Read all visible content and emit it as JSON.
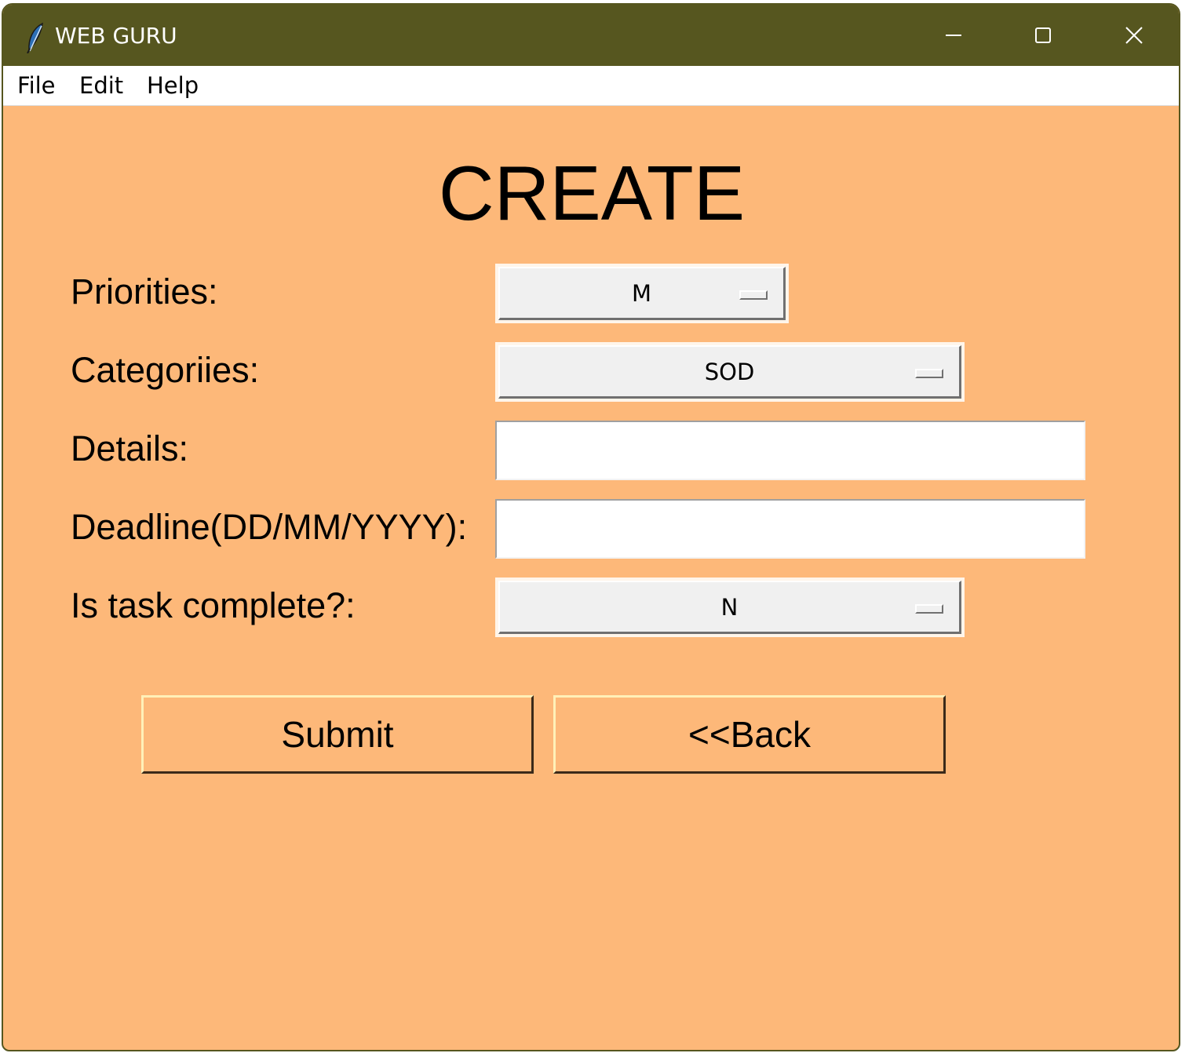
{
  "window": {
    "title": "WEB GURU",
    "icon": "feather-icon",
    "controls": [
      "minimize-icon",
      "maximize-icon",
      "close-icon"
    ],
    "titlebar_color": "#56561f",
    "background_color": "#fdb879"
  },
  "menu": {
    "file": "File",
    "edit": "Edit",
    "help": "Help"
  },
  "form": {
    "heading": "CREATE",
    "priorities_label": "Priorities:",
    "priorities_value": "M",
    "categories_label": "Categoriies:",
    "categories_value": "SOD",
    "details_label": "Details:",
    "details_value": "",
    "deadline_label": "Deadline(DD/MM/YYYY):",
    "deadline_value": "",
    "complete_label": "Is task complete?:",
    "complete_value": "N"
  },
  "buttons": {
    "submit": "Submit",
    "back": "<<Back"
  }
}
